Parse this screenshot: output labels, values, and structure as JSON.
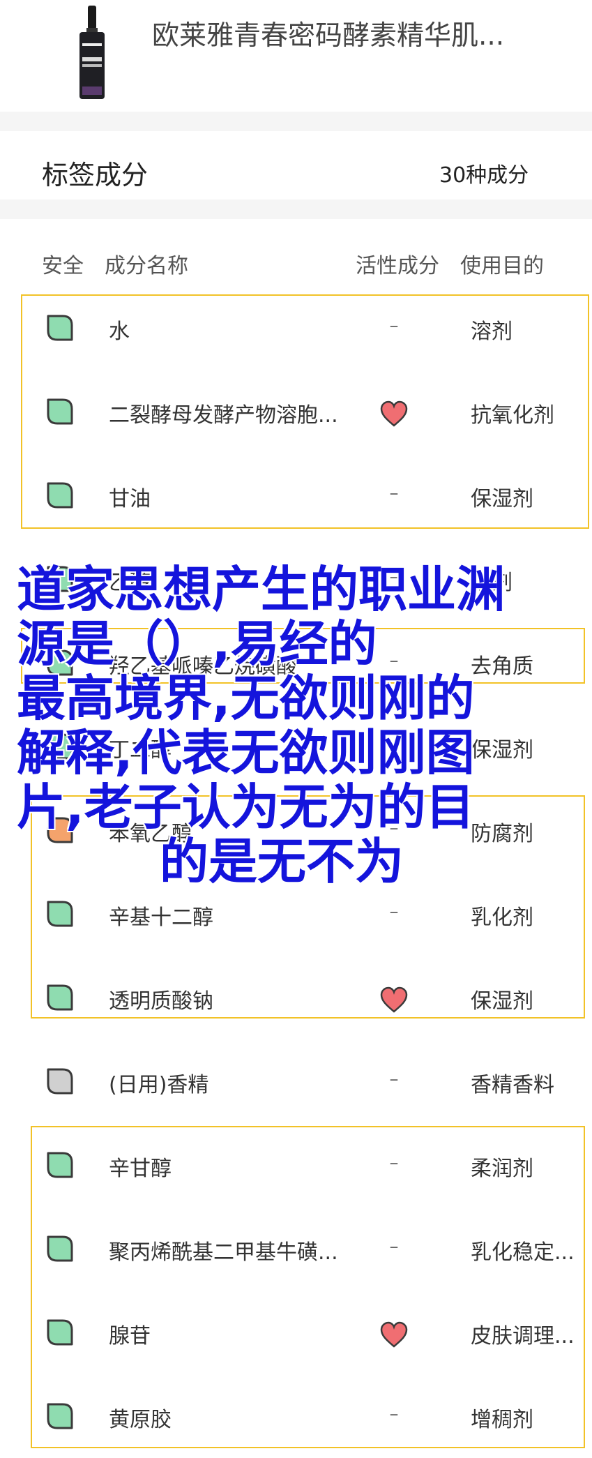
{
  "product": {
    "name": "欧莱雅青春密码酵素精华肌...",
    "thumb_label_top": "PAR JSLOA",
    "thumb_label_mid": "YOUTH CODE"
  },
  "tags": {
    "title": "标签成分",
    "count": "30种成分"
  },
  "columns": {
    "safety": "安全",
    "name": "成分名称",
    "active": "活性成分",
    "purpose": "使用目的"
  },
  "colors": {
    "safe_green": "#8fdcb0",
    "neutral_gray": "#d0d0d0",
    "heart_red": "#f06e72",
    "highlight_border": "#f2c227",
    "overlay_blue": "#1414dc"
  },
  "ingredients": [
    {
      "name": "水",
      "safety": "green",
      "active": "–",
      "purpose": "溶剂"
    },
    {
      "name": "二裂酵母发酵产物溶胞...",
      "safety": "green",
      "active": "heart",
      "purpose": "抗氧化剂"
    },
    {
      "name": "甘油",
      "safety": "green",
      "active": "–",
      "purpose": "保湿剂"
    },
    {
      "name": "乙醇",
      "safety": "green",
      "active": "–",
      "purpose": "溶剂"
    },
    {
      "name": "羟乙基哌嗪乙烷磺酸",
      "safety": "green",
      "active": "–",
      "purpose": "去角质"
    },
    {
      "name": "丁二醇",
      "safety": "green",
      "active": "–",
      "purpose": "保湿剂"
    },
    {
      "name": "苯氧乙醇",
      "safety": "orange",
      "active": "–",
      "purpose": "防腐剂"
    },
    {
      "name": "辛基十二醇",
      "safety": "green",
      "active": "–",
      "purpose": "乳化剂"
    },
    {
      "name": "透明质酸钠",
      "safety": "green",
      "active": "heart",
      "purpose": "保湿剂"
    },
    {
      "name": "(日用)香精",
      "safety": "gray",
      "active": "–",
      "purpose": "香精香料"
    },
    {
      "name": "辛甘醇",
      "safety": "green",
      "active": "–",
      "purpose": "柔润剂"
    },
    {
      "name": "聚丙烯酰基二甲基牛磺...",
      "safety": "green",
      "active": "–",
      "purpose": "乳化稳定..."
    },
    {
      "name": "腺苷",
      "safety": "green",
      "active": "heart",
      "purpose": "皮肤调理..."
    },
    {
      "name": "黄原胶",
      "safety": "green",
      "active": "–",
      "purpose": "增稠剂"
    }
  ],
  "overlay": {
    "lines": [
      "道家思想产生的职业渊",
      "源是（）,易经的",
      "最高境界,无欲则刚的",
      "解释,代表无欲则刚图",
      "片,老子认为无为的目",
      "的是无不为"
    ]
  }
}
